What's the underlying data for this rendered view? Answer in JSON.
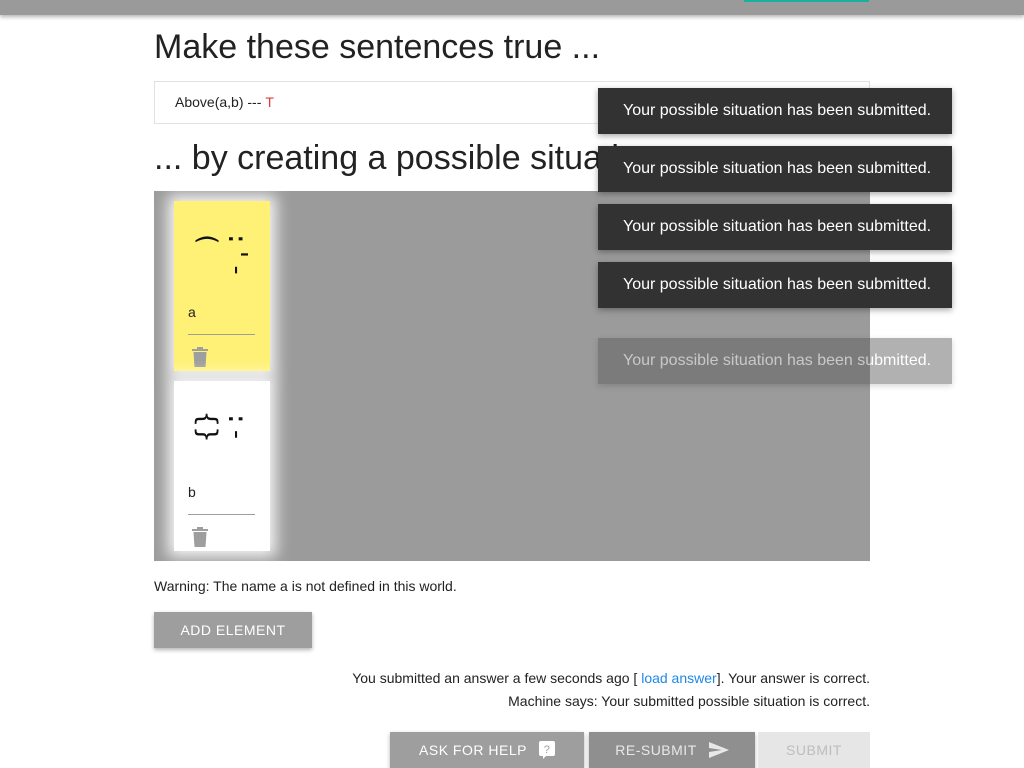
{
  "heading_top": "Make these sentences true ...",
  "sentence": {
    "formula": "Above(a,b) ---",
    "truth": "T"
  },
  "heading_world": "... by creating a possible situation",
  "world": {
    "elements": [
      {
        "name": "a",
        "face": ":'-(",
        "color": "#fff176"
      },
      {
        "name": "b",
        "face": ":-{}",
        "color": "#ffffff"
      }
    ]
  },
  "warning": "Warning: The name a is not defined in this world.",
  "add_element_label": "ADD ELEMENT",
  "status": {
    "line1_prefix": "You submitted an answer a few seconds ago [",
    "load_answer": "load answer",
    "line1_suffix": "]. Your answer is correct.",
    "line2": "Machine says: Your submitted possible situation is correct."
  },
  "buttons": {
    "ask_for_help": "ASK FOR HELP",
    "resubmit": "RE-SUBMIT",
    "submit": "SUBMIT"
  },
  "toasts": [
    "Your possible situation has been submitted.",
    "Your possible situation has been submitted.",
    "Your possible situation has been submitted.",
    "Your possible situation has been submitted.",
    "Your possible situation has been submitted."
  ]
}
